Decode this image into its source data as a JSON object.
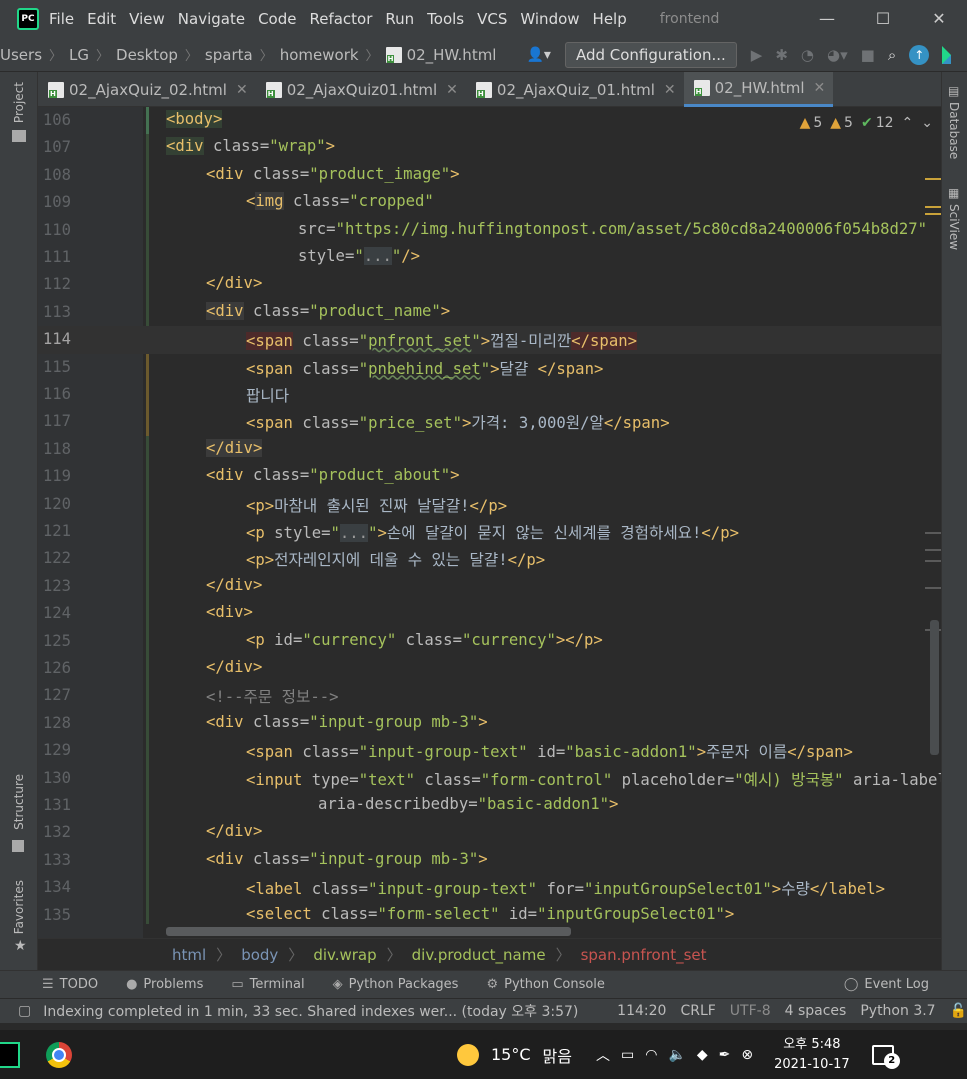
{
  "app": {
    "logo_text": "PC",
    "menu": [
      "File",
      "Edit",
      "View",
      "Navigate",
      "Code",
      "Refactor",
      "Run",
      "Tools",
      "VCS",
      "Window",
      "Help"
    ],
    "project_title": "frontend",
    "window_controls": [
      "—",
      "☐",
      "✕"
    ]
  },
  "nav": {
    "crumbs": [
      "Users",
      "LG",
      "Desktop",
      "sparta",
      "homework",
      "02_HW.html"
    ],
    "add_configuration": "Add Configuration..."
  },
  "tool_windows": {
    "left": [
      "Project",
      "Structure",
      "Favorites"
    ],
    "right": [
      "Database",
      "SciView"
    ]
  },
  "tabs": [
    {
      "label": "02_AjaxQuiz_02.html",
      "active": false
    },
    {
      "label": "02_AjaxQuiz01.html",
      "active": false
    },
    {
      "label": "02_AjaxQuiz_01.html",
      "active": false
    },
    {
      "label": "02_HW.html",
      "active": true
    }
  ],
  "inspections": {
    "warnings_a": "5",
    "warnings_b": "5",
    "checks": "12"
  },
  "editor": {
    "current_line": 114,
    "lines": [
      {
        "n": "106",
        "i": 0,
        "h": "<span class='t hl'>&lt;body&gt;</span>"
      },
      {
        "n": "107",
        "i": 0,
        "h": "<span class='t hl'>&lt;div</span> <span class='a'>class=</span><span class='v'>\"wrap\"</span><span class='t'>&gt;</span>"
      },
      {
        "n": "108",
        "i": 1,
        "h": "<span class='t'>&lt;div</span> <span class='a'>class=</span><span class='v'>\"product_image\"</span><span class='t'>&gt;</span>"
      },
      {
        "n": "109",
        "i": 2,
        "h": "<span class='t'>&lt;</span><span class='t hlp'>img</span> <span class='a'>class=</span><span class='v'>\"cropped\"</span>"
      },
      {
        "n": "110",
        "i": 3.3,
        "h": "<span class='a'>src=</span><span class='v'>\"https://img.huffingtonpost.com/asset/5c80cd8a2400006f054b8d27\"</span>"
      },
      {
        "n": "111",
        "i": 3.3,
        "h": "<span class='a'>style=</span><span class='v'>\"<span class='fold-txt'>...</span>\"</span><span class='t'>/&gt;</span>"
      },
      {
        "n": "112",
        "i": 1,
        "h": "<span class='t'>&lt;/div&gt;</span>"
      },
      {
        "n": "113",
        "i": 1,
        "h": "<span class='t hlp'>&lt;div</span> <span class='a'>class=</span><span class='v'>\"product_name\"</span><span class='t'>&gt;</span>"
      },
      {
        "n": "114",
        "i": 2,
        "h": "<span class='t hlr'>&lt;span</span> <span class='a'>class=</span><span class='v'>\"<span class='wv'>pnfront_set</span>\"</span><span class='t'>&gt;</span><span class='tx'>껍질-미리깐</span><span class='t hlr'>&lt;/span&gt;</span>"
      },
      {
        "n": "115",
        "i": 2,
        "h": "<span class='t'>&lt;span</span> <span class='a'>class=</span><span class='v'>\"<span class='wv'>pnbehind_set</span>\"</span><span class='t'>&gt;</span><span class='tx'>달걀 </span><span class='t'>&lt;/span&gt;</span>"
      },
      {
        "n": "116",
        "i": 2,
        "h": "<span class='tx'>팝니다</span>"
      },
      {
        "n": "117",
        "i": 2,
        "h": "<span class='t'>&lt;span</span> <span class='a'>class=</span><span class='v'>\"price_set\"</span><span class='t'>&gt;</span><span class='tx'>가격: 3,000원/알</span><span class='t'>&lt;/span&gt;</span>"
      },
      {
        "n": "118",
        "i": 1,
        "h": "<span class='t hlp'>&lt;/div&gt;</span>"
      },
      {
        "n": "119",
        "i": 1,
        "h": "<span class='t'>&lt;div</span> <span class='a'>class=</span><span class='v'>\"product_about\"</span><span class='t'>&gt;</span>"
      },
      {
        "n": "120",
        "i": 2,
        "h": "<span class='t'>&lt;p&gt;</span><span class='tx'>마참내 출시된 진짜 날달걀!</span><span class='t'>&lt;/p&gt;</span>"
      },
      {
        "n": "121",
        "i": 2,
        "h": "<span class='t'>&lt;p</span> <span class='a'>style=</span><span class='v'>\"<span class='fold-txt'>...</span>\"</span><span class='t'>&gt;</span><span class='tx'>손에 달걀이 묻지 않는 신세계를 경험하세요!</span><span class='t'>&lt;/p&gt;</span>"
      },
      {
        "n": "122",
        "i": 2,
        "h": "<span class='t'>&lt;p&gt;</span><span class='tx'>전자레인지에 데울 수 있는 달걀!</span><span class='t'>&lt;/p&gt;</span>"
      },
      {
        "n": "123",
        "i": 1,
        "h": "<span class='t'>&lt;/div&gt;</span>"
      },
      {
        "n": "124",
        "i": 1,
        "h": "<span class='t'>&lt;div&gt;</span>"
      },
      {
        "n": "125",
        "i": 2,
        "h": "<span class='t'>&lt;p</span> <span class='a'>id=</span><span class='v'>\"currency\"</span> <span class='a'>class=</span><span class='v'>\"currency\"</span><span class='t'>&gt;&lt;/p&gt;</span>"
      },
      {
        "n": "126",
        "i": 1,
        "h": "<span class='t'>&lt;/div&gt;</span>"
      },
      {
        "n": "127",
        "i": 1,
        "h": "<span class='cm'>&lt;!--주문 정보--&gt;</span>"
      },
      {
        "n": "128",
        "i": 1,
        "h": "<span class='t'>&lt;div</span> <span class='a'>class=</span><span class='v'>\"input-group mb-3\"</span><span class='t'>&gt;</span>"
      },
      {
        "n": "129",
        "i": 2,
        "h": "<span class='t'>&lt;span</span> <span class='a'>class=</span><span class='v'>\"input-group-text\"</span> <span class='a'>id=</span><span class='v'>\"basic-addon1\"</span><span class='t'>&gt;</span><span class='tx'>주문자 이름</span><span class='t'>&lt;/span&gt;</span>"
      },
      {
        "n": "130",
        "i": 2,
        "h": "<span class='t'>&lt;input</span> <span class='a'>type=</span><span class='v'>\"text\"</span> <span class='a'>class=</span><span class='v'>\"form-control\"</span> <span class='a'>placeholder=</span><span class='v'>\"예시) 방국봉\"</span> <span class='a'>aria-label=</span><span class='v'>\"Username\"</span>"
      },
      {
        "n": "131",
        "i": 3.8,
        "h": "<span class='a'>aria-describedby=</span><span class='v'>\"basic-addon1\"</span><span class='t'>&gt;</span>"
      },
      {
        "n": "132",
        "i": 1,
        "h": "<span class='t'>&lt;/div&gt;</span>"
      },
      {
        "n": "133",
        "i": 1,
        "h": "<span class='t'>&lt;div</span> <span class='a'>class=</span><span class='v'>\"input-group mb-3\"</span><span class='t'>&gt;</span>"
      },
      {
        "n": "134",
        "i": 2,
        "h": "<span class='t'>&lt;label</span> <span class='a'>class=</span><span class='v'>\"input-group-text\"</span> <span class='a'>for=</span><span class='v'>\"inputGroupSelect01\"</span><span class='t'>&gt;</span><span class='tx'>수량</span><span class='t'>&lt;/label&gt;</span>"
      },
      {
        "n": "135",
        "i": 2,
        "h": "<span class='t'>&lt;select</span> <span class='a'>class=</span><span class='v'>\"form-select\"</span> <span class='a'>id=</span><span class='v'>\"inputGroupSelect01\"</span><span class='t'>&gt;</span>"
      }
    ]
  },
  "breadcrumbs": [
    "html",
    "body",
    "div.wrap",
    "div.product_name",
    "span.pnfront_set"
  ],
  "bottom_tools": [
    "TODO",
    "Problems",
    "Terminal",
    "Python Packages",
    "Python Console"
  ],
  "event_log": "Event Log",
  "status": {
    "message": "Indexing completed in 1 min, 33 sec. Shared indexes wer... (today 오후 3:57)",
    "position": "114:20",
    "line_sep": "CRLF",
    "encoding": "UTF-8",
    "indent": "4 spaces",
    "interpreter": "Python 3.7"
  },
  "taskbar": {
    "temperature": "15°C",
    "weather": "맑음",
    "time": "오후 5:48",
    "date": "2021-10-17",
    "notifications": "2"
  },
  "colors": {
    "tag": "#e8bf6a",
    "attr": "#bababa",
    "value": "#a5c25c",
    "comment": "#808080",
    "accent": "#4a88c7"
  }
}
